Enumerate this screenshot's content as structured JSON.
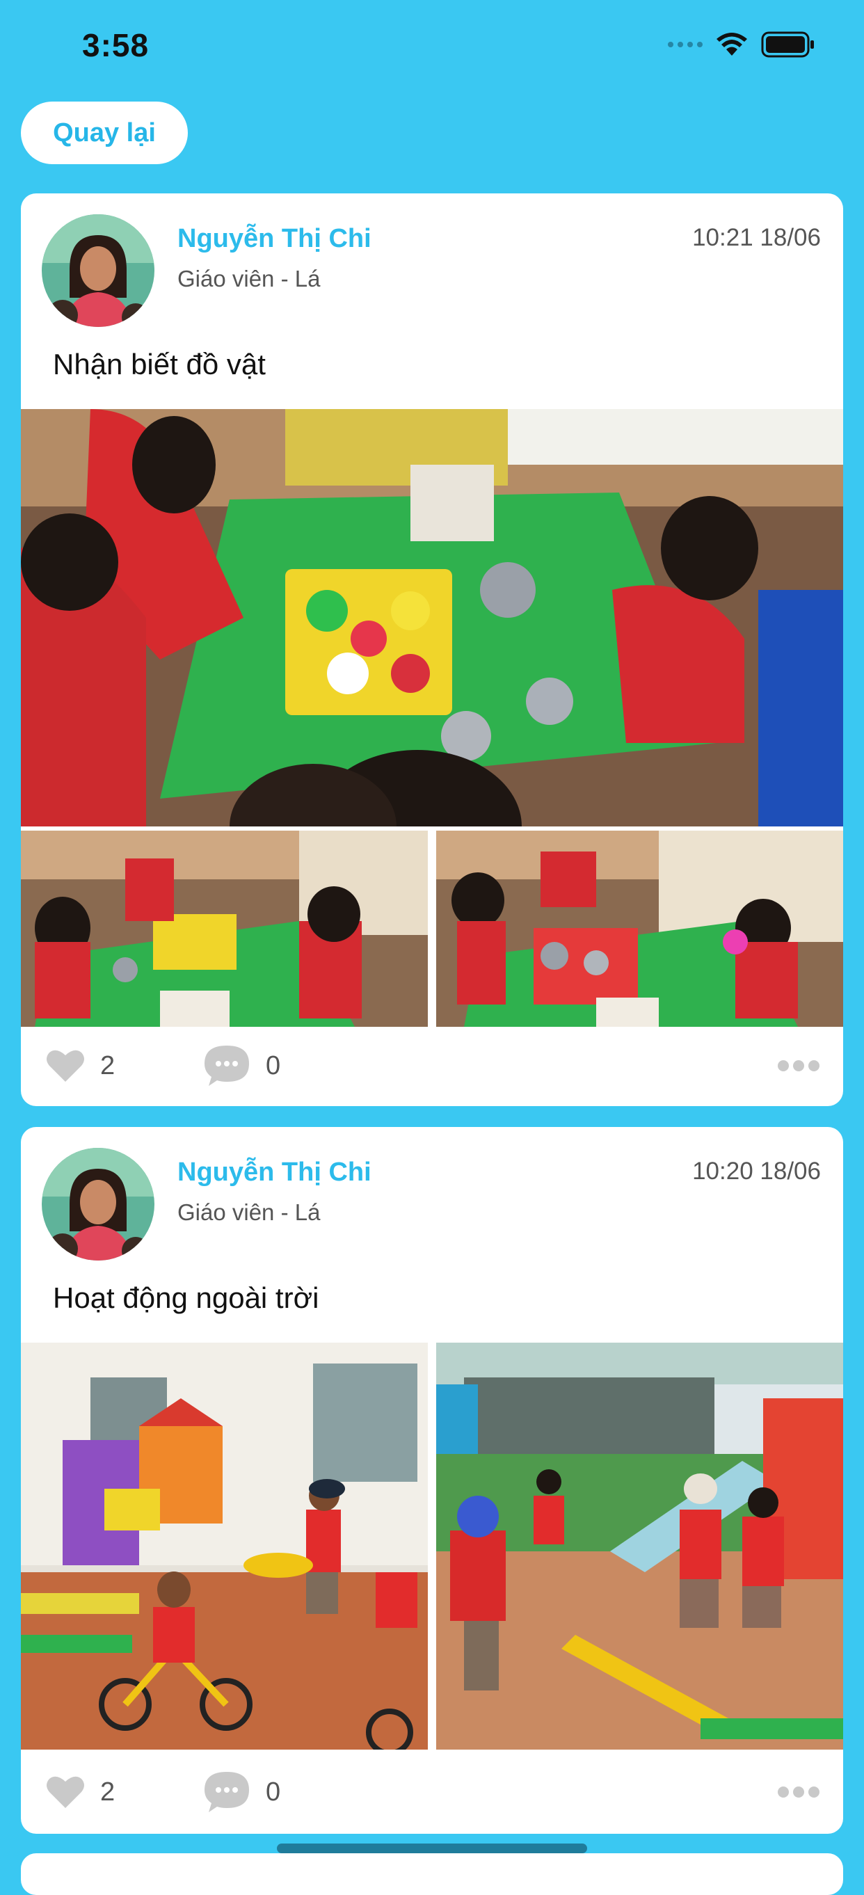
{
  "status_bar": {
    "time": "3:58"
  },
  "nav": {
    "back_label": "Quay lại"
  },
  "posts": [
    {
      "author": "Nguyễn Thị Chi",
      "role": "Giáo viên - Lá",
      "timestamp": "10:21 18/06",
      "caption": "Nhận biết đồ vật",
      "likes": "2",
      "comments": "0"
    },
    {
      "author": "Nguyễn Thị Chi",
      "role": "Giáo viên - Lá",
      "timestamp": "10:20 18/06",
      "caption": "Hoạt động ngoài trời",
      "likes": "2",
      "comments": "0"
    }
  ],
  "icons": {
    "wifi": "wifi-icon",
    "battery": "battery-icon",
    "like": "heart-icon",
    "comment": "comment-bubble-icon",
    "more": "more-dots-icon"
  },
  "colors": {
    "background": "#3ac8f2",
    "accent": "#2cbbeb",
    "card": "#ffffff"
  }
}
